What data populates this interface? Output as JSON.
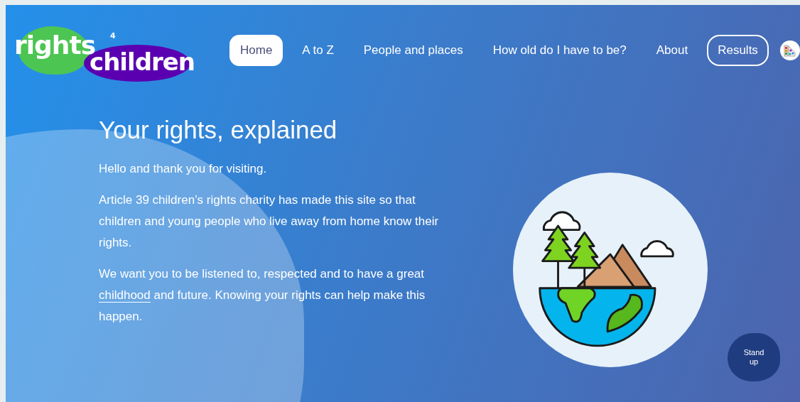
{
  "logo": {
    "word_1": "rights",
    "number": "4",
    "word_2": "children"
  },
  "nav": [
    {
      "label": "Home",
      "kind": "link",
      "selected": true
    },
    {
      "label": "A to Z",
      "kind": "link",
      "selected": false
    },
    {
      "label": "People and places",
      "kind": "link",
      "selected": false
    },
    {
      "label": "How old do I have to be?",
      "kind": "link",
      "selected": false
    },
    {
      "label": "About",
      "kind": "link",
      "selected": false
    },
    {
      "label": "Results",
      "kind": "outlined",
      "selected": false
    }
  ],
  "hero": {
    "title": "Your rights, explained",
    "paragraphs": [
      {
        "before": "Hello and thank you for visiting."
      },
      {
        "before": "Article 39 children’s rights charity has made this site so that children and young people who live away from home know their rights."
      },
      {
        "before": "We want you to be listened to, respected and to have a great ",
        "link": "childhood",
        "after": " and future. Knowing your rights can help make this happen."
      }
    ]
  },
  "stand_up_button": "Stand up"
}
